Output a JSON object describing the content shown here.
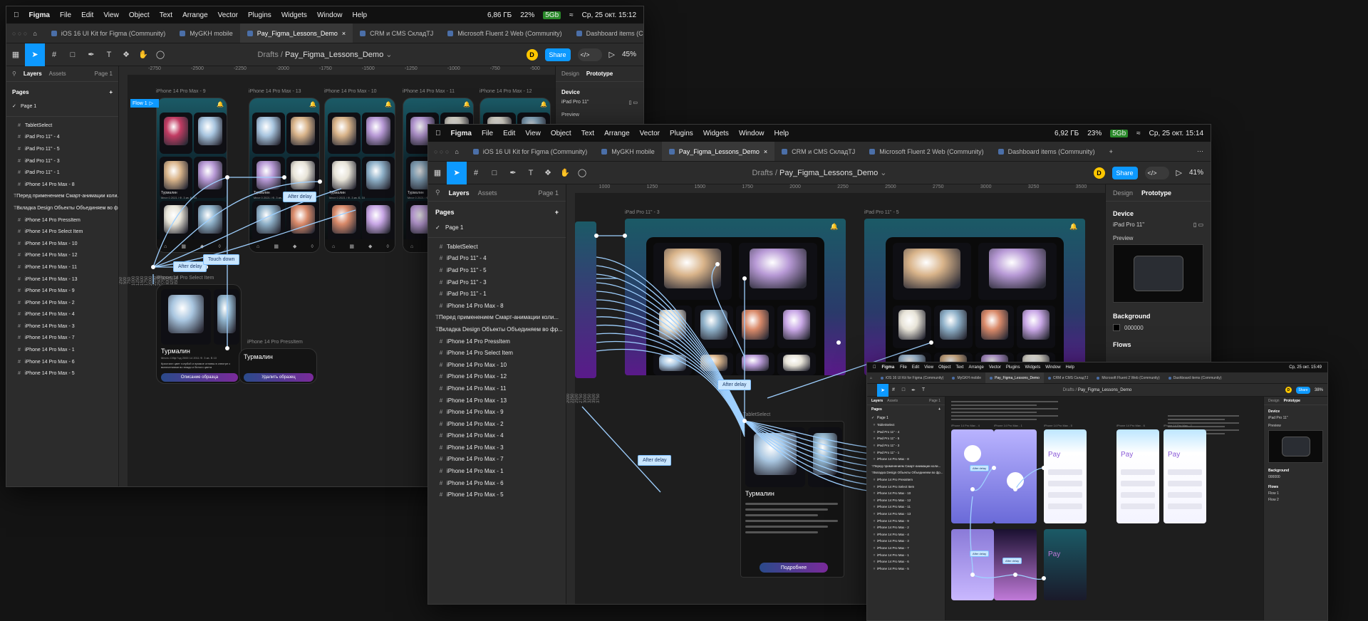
{
  "menubar": {
    "app": "Figma",
    "items": [
      "File",
      "Edit",
      "View",
      "Object",
      "Text",
      "Arrange",
      "Vector",
      "Plugins",
      "Widgets",
      "Window",
      "Help"
    ],
    "w1": {
      "mem": "6,86 ГБ",
      "battery": "22%",
      "badge": "5Gb",
      "datetime": "Ср, 25 окт. 15:12"
    },
    "w2": {
      "mem": "6,92 ГБ",
      "battery": "23%",
      "badge": "5Gb",
      "datetime": "Ср, 25 окт. 15:14"
    },
    "w3": {
      "datetime": "Ср, 25 окт. 15:49"
    }
  },
  "tabs": [
    {
      "label": "iOS 16 UI Kit for Figma (Community)"
    },
    {
      "label": "MyGKH mobile"
    },
    {
      "label": "Pay_Figma_Lessons_Demo",
      "active": true
    },
    {
      "label": "CRM и CMS СкладTJ"
    },
    {
      "label": "Microsoft Fluent 2 Web (Community)"
    },
    {
      "label": "Dashboard items (Community)"
    }
  ],
  "toolbar": {
    "drafts": "Drafts",
    "file": "Pay_Figma_Lessons_Demo",
    "avatar": "D",
    "share": "Share",
    "zoom1": "45%",
    "zoom2": "41%",
    "zoom3": "38%"
  },
  "left_panel": {
    "layers_tab": "Layers",
    "assets_tab": "Assets",
    "page_sel": "Page 1",
    "pages_title": "Pages",
    "page_current": "Page 1",
    "layers": [
      {
        "name": "TabletSelect",
        "kind": "grid"
      },
      {
        "name": "iPad Pro 11\" - 4",
        "kind": "grid"
      },
      {
        "name": "iPad Pro 11\" - 5",
        "kind": "grid"
      },
      {
        "name": "iPad Pro 11\" - 3",
        "kind": "grid"
      },
      {
        "name": "iPad Pro 11\" - 1",
        "kind": "grid"
      },
      {
        "name": "iPhone 14 Pro Max - 8",
        "kind": "grid"
      },
      {
        "name": "Перед применением Смарт-анимации коли...",
        "kind": "text"
      },
      {
        "name": "Вкладка Design Объекты Объединяем во фр...",
        "kind": "text"
      },
      {
        "name": "iPhone 14 Pro PressItem",
        "kind": "grid"
      },
      {
        "name": "iPhone 14 Pro Select Item",
        "kind": "grid"
      },
      {
        "name": "iPhone 14 Pro Max - 10",
        "kind": "grid"
      },
      {
        "name": "iPhone 14 Pro Max - 12",
        "kind": "grid"
      },
      {
        "name": "iPhone 14 Pro Max - 11",
        "kind": "grid"
      },
      {
        "name": "iPhone 14 Pro Max - 13",
        "kind": "grid"
      },
      {
        "name": "iPhone 14 Pro Max - 9",
        "kind": "grid"
      },
      {
        "name": "iPhone 14 Pro Max - 2",
        "kind": "grid"
      },
      {
        "name": "iPhone 14 Pro Max - 4",
        "kind": "grid"
      },
      {
        "name": "iPhone 14 Pro Max - 3",
        "kind": "grid"
      },
      {
        "name": "iPhone 14 Pro Max - 7",
        "kind": "grid"
      },
      {
        "name": "iPhone 14 Pro Max - 1",
        "kind": "grid"
      },
      {
        "name": "iPhone 14 Pro Max - 6",
        "kind": "grid"
      },
      {
        "name": "iPhone 14 Pro Max - 5",
        "kind": "grid"
      }
    ]
  },
  "right_panel": {
    "design_tab": "Design",
    "prototype_tab": "Prototype",
    "device_title": "Device",
    "device_value": "iPad Pro 11\"",
    "preview_title": "Preview",
    "background_title": "Background",
    "background_value": "000000",
    "flows_title": "Flows",
    "flow1": "Flow 1",
    "flow2": "Flow 2"
  },
  "canvas1": {
    "ruler": [
      "-2750",
      "-2500",
      "-2250",
      "-2000",
      "-1750",
      "-1500",
      "-1250",
      "-1000",
      "-750",
      "-500"
    ],
    "ruler_left": [
      "250",
      "500",
      "750",
      "1000",
      "1250",
      "1500",
      "1750",
      "2000",
      "2250",
      "2500",
      "2750",
      "3000",
      "3250",
      "3500"
    ],
    "frames": [
      "iPhone 14 Pro Max - 9",
      "iPhone 14 Pro Max - 13",
      "iPhone 14 Pro Max - 10",
      "iPhone 14 Pro Max - 11",
      "iPhone 14 Pro Max - 12",
      "iPhone 14 Pro Select Item",
      "iPhone 14 Pro PressItem"
    ],
    "flow_tag": "Flow 1",
    "conn_after_delay": "After delay",
    "conn_touch_down": "Touch down",
    "item_title": "Турмалин",
    "item_meta": "Место Сбф Год 2000 14 2011 Ф. 3 кв. В 10",
    "item_desc": "Кристалл цвет голубой и прямое отливы в спектре с включениями во впади и белого цвета",
    "btn_describe": "Описание образца",
    "btn_delete": "Удалить образец",
    "card_label": "Турмалин",
    "card_meta": "Мест 0 2021 / Ф. 3 кв. Б, 10"
  },
  "canvas2": {
    "ruler": [
      "1000",
      "1250",
      "1500",
      "1750",
      "2000",
      "2250",
      "2500",
      "2750",
      "3000",
      "3250",
      "3500"
    ],
    "ruler_left": [
      "2000",
      "2250",
      "2500",
      "2750",
      "3000",
      "3250",
      "3500",
      "3750"
    ],
    "frames": [
      "iPad Pro 11\" - 3",
      "iPad Pro 11\" - 5",
      "TabletSelect"
    ],
    "conn_after_delay": "After delay",
    "btn_more": "Подробнее",
    "item_title": "Турмалин"
  },
  "canvas3": {
    "frames": [
      "iPhone 14 Pro Max - 4",
      "iPhone 14 Pro Max - 1",
      "iPhone 14 Pro Max - 5",
      "iPhone 14 Pro Max - 6",
      "iPhone 14 Pro Max - 7"
    ],
    "pay": "Pay",
    "conn_after_delay": "After delay"
  },
  "colors": {
    "accent": "#0d99ff",
    "panel": "#2c2c2c",
    "canvas": "#1e1e1e",
    "wire": "#9fd0ff",
    "teal": "#1b5a66",
    "purple": "#5a1a8a"
  },
  "icons": {
    "apple": "apple-icon",
    "home": "home-icon",
    "move": "move-icon",
    "frame": "frame-icon",
    "pen": "pen-icon",
    "text": "text-tool-icon",
    "hand": "hand-icon",
    "comment": "comment-icon",
    "play": "play-icon",
    "search": "search-icon",
    "plus": "plus-icon",
    "check": "check-icon"
  }
}
